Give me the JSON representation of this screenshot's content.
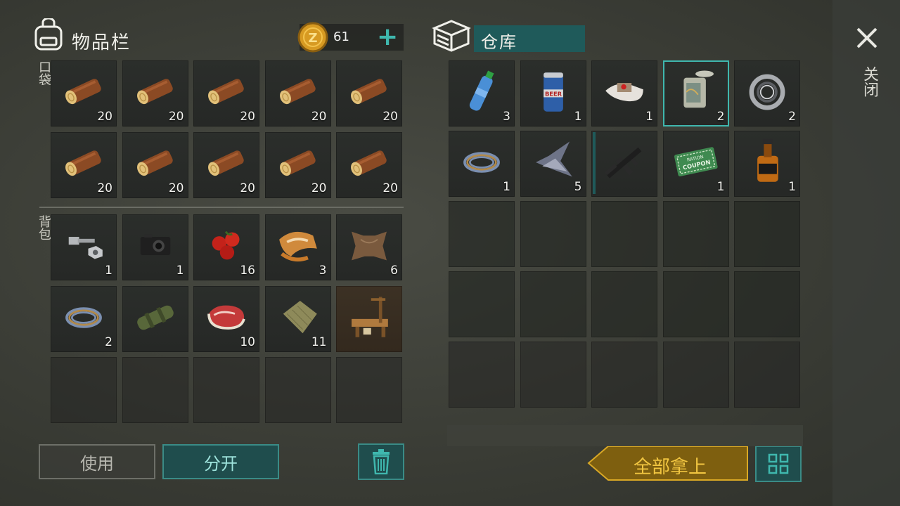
{
  "inventory": {
    "title": "物品栏",
    "coins": "61",
    "section_pockets": "口袋",
    "section_backpack": "背包",
    "pockets": [
      {
        "icon": "log-icon",
        "count": "20"
      },
      {
        "icon": "log-icon",
        "count": "20"
      },
      {
        "icon": "log-icon",
        "count": "20"
      },
      {
        "icon": "log-icon",
        "count": "20"
      },
      {
        "icon": "log-icon",
        "count": "20"
      },
      {
        "icon": "log-icon",
        "count": "20"
      },
      {
        "icon": "log-icon",
        "count": "20"
      },
      {
        "icon": "log-icon",
        "count": "20"
      },
      {
        "icon": "log-icon",
        "count": "20"
      },
      {
        "icon": "log-icon",
        "count": "20"
      }
    ],
    "backpack": [
      {
        "icon": "bolt-nut-icon",
        "count": "1"
      },
      {
        "icon": "camera-icon",
        "count": "1"
      },
      {
        "icon": "berries-icon",
        "count": "16"
      },
      {
        "icon": "fox-fur-icon",
        "count": "3"
      },
      {
        "icon": "leather-hide-icon",
        "count": "6"
      },
      {
        "icon": "wire-coil-icon",
        "count": "2"
      },
      {
        "icon": "green-pipe-icon",
        "count": ""
      },
      {
        "icon": "raw-meat-icon",
        "count": "10"
      },
      {
        "icon": "cloth-icon",
        "count": "11"
      },
      {
        "icon": "drying-rack-icon",
        "count": ""
      }
    ]
  },
  "storage": {
    "title": "仓库",
    "items": [
      {
        "icon": "water-bottle-icon",
        "count": "3"
      },
      {
        "icon": "beer-can-icon",
        "count": "1",
        "label": "BEER"
      },
      {
        "icon": "bandage-icon",
        "count": "1"
      },
      {
        "icon": "tin-can-icon",
        "count": "2"
      },
      {
        "icon": "bearing-icon",
        "count": "2"
      },
      {
        "icon": "wire-coil-icon",
        "count": "1"
      },
      {
        "icon": "scrap-metal-icon",
        "count": "5"
      },
      {
        "icon": "assault-rifle-icon",
        "count": ""
      },
      {
        "icon": "ration-coupon-icon",
        "count": "1",
        "label1": "RATION",
        "label2": "COUPON"
      },
      {
        "icon": "whiskey-bottle-icon",
        "count": "1"
      }
    ]
  },
  "buttons": {
    "use": "使用",
    "split": "分开",
    "take_all": "全部拿上",
    "close": "关闭"
  },
  "colors": {
    "accent": "#3fb7ae",
    "button_teal": "#1f4d4d",
    "take_all": "#8a6b12",
    "take_all_text": "#f2c641"
  }
}
